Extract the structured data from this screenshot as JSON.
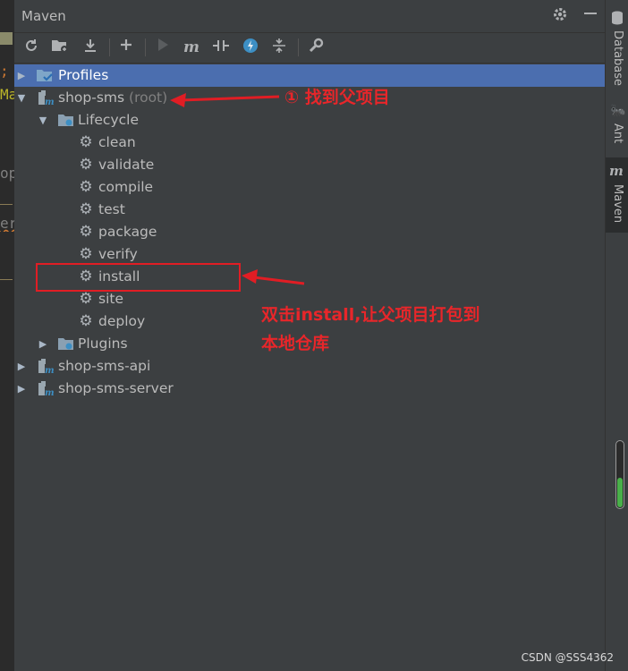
{
  "editor_fragments": [
    ";",
    "Ma",
    "op",
    "er"
  ],
  "panel": {
    "title": "Maven",
    "title_icons": [
      "gear-icon",
      "minimize-icon"
    ]
  },
  "toolbar": {
    "tools": [
      {
        "name": "reload-icon",
        "glyph": "⟳"
      },
      {
        "name": "add-folder-icon",
        "glyph": "▬"
      },
      {
        "name": "download-icon",
        "glyph": "⤓"
      },
      {
        "name": "add-icon",
        "glyph": "+"
      },
      {
        "name": "run-icon",
        "glyph": "▶"
      },
      {
        "name": "maven-goal-icon",
        "glyph": "m"
      },
      {
        "name": "toggle-offline-icon",
        "glyph": "⫳"
      },
      {
        "name": "skip-tests-icon",
        "glyph": "⚡"
      },
      {
        "name": "collapse-all-icon",
        "glyph": "⇕"
      },
      {
        "name": "settings-wrench-icon",
        "glyph": "🔧"
      }
    ]
  },
  "tree": {
    "profiles": "Profiles",
    "root_project": "shop-sms",
    "root_suffix": "(root)",
    "lifecycle": "Lifecycle",
    "goals": [
      "clean",
      "validate",
      "compile",
      "test",
      "package",
      "verify",
      "install",
      "site",
      "deploy"
    ],
    "plugins": "Plugins",
    "modules": [
      "shop-sms-api",
      "shop-sms-server"
    ]
  },
  "right_tabs": [
    "Database",
    "Ant",
    "Maven"
  ],
  "annotations": {
    "find_parent": "① 找到父项目",
    "install_line1": "双击install,让父项目打包到",
    "install_line2": "本地仓库"
  },
  "progress": {
    "fill_fraction": 0.45
  },
  "watermark": "CSDN @SSS4362",
  "colors": {
    "selection": "#4b6eaf",
    "annotation": "#e8262a",
    "progress": "#49b04a"
  }
}
